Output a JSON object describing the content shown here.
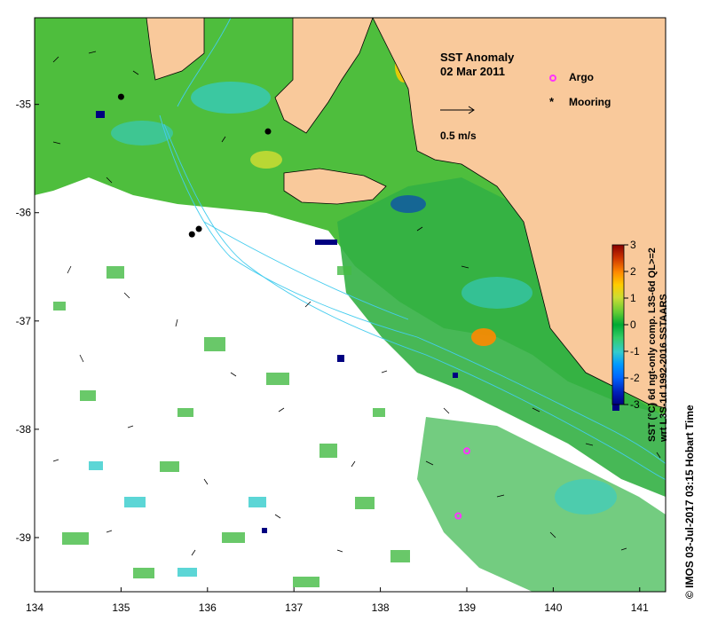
{
  "title": {
    "line1": "SST Anomaly",
    "line2": "02 Mar 2011"
  },
  "vector_scale": {
    "label": "0.5 m/s"
  },
  "legend": {
    "argo_label": "Argo",
    "mooring_label": "Mooring",
    "argo_color": "#ff33ff",
    "mooring_color": "#000000"
  },
  "colorbar": {
    "ticks": [
      "3",
      "2",
      "1",
      "0",
      "-1",
      "-2",
      "-3"
    ],
    "label_line1": "SST (°C) 6d ngt-only comp. L3S-6d QL>=2",
    "label_line2": "wrt L3S-1d 1992-2016 SSTAARS",
    "range": [
      -3,
      3
    ],
    "colors": [
      "#000080",
      "#0033cc",
      "#0099ff",
      "#33cccc",
      "#33cc66",
      "#00aa33",
      "#66cc33",
      "#ccdd33",
      "#ffcc00",
      "#ff6600",
      "#cc3300",
      "#880000"
    ]
  },
  "axes": {
    "x_ticks": [
      "134",
      "135",
      "136",
      "137",
      "138",
      "139",
      "140",
      "141"
    ],
    "y_ticks": [
      "-35",
      "-36",
      "-37",
      "-38",
      "-39"
    ],
    "lon_range": [
      134,
      141.3
    ],
    "lat_range": [
      -39.5,
      -34.2
    ]
  },
  "credit": "© IMOS 03-Jul-2017 03:15 Hobart Time",
  "colors": {
    "land": "#f9c99b",
    "ocean_missing": "#ffffff",
    "anomaly_zero": "#33bb44",
    "anomaly_cool": "#33ccdd",
    "anomaly_warm": "#ccdd33",
    "contour": "#44ccee",
    "frame": "#000000"
  },
  "markers": {
    "argo": [
      {
        "lon": 139.0,
        "lat": -38.2
      },
      {
        "lon": 138.9,
        "lat": -38.8
      }
    ],
    "mooring": [
      {
        "lon": 135.0,
        "lat": -34.93
      },
      {
        "lon": 136.7,
        "lat": -35.25
      },
      {
        "lon": 135.9,
        "lat": -36.15
      },
      {
        "lon": 135.82,
        "lat": -36.2
      }
    ]
  }
}
